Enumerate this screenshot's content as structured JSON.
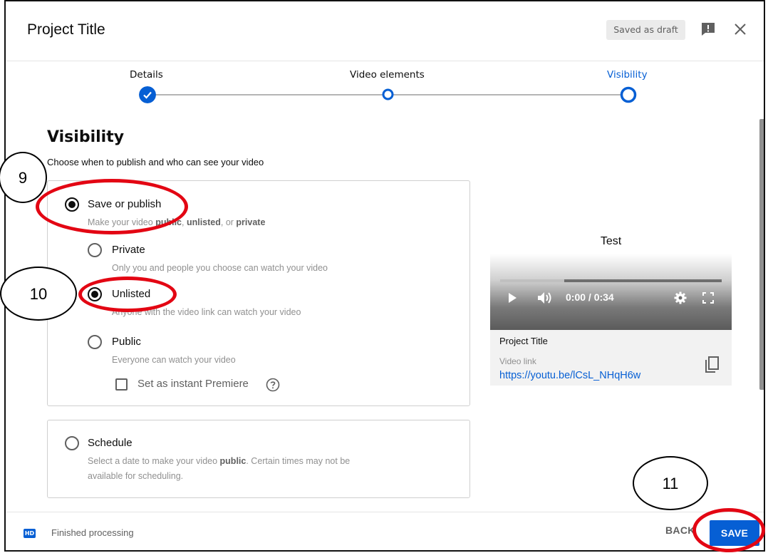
{
  "header": {
    "title": "Project Title",
    "draft_badge": "Saved as draft"
  },
  "stepper": {
    "steps": [
      {
        "label": "Details",
        "state": "completed"
      },
      {
        "label": "Video elements",
        "state": "pending"
      },
      {
        "label": "Visibility",
        "state": "current"
      }
    ]
  },
  "visibility": {
    "title": "Visibility",
    "subtitle": "Choose when to publish and who can see your video",
    "save_publish": {
      "label": "Save or publish",
      "desc_prefix": "Make your video ",
      "desc_public": "public",
      "desc_sep": ", ",
      "desc_unlisted": "unlisted",
      "desc_or": ", or ",
      "desc_private": "private",
      "selected": true
    },
    "options": [
      {
        "label": "Private",
        "desc": "Only you and people you choose can watch your video",
        "selected": false
      },
      {
        "label": "Unlisted",
        "desc": "Anyone with the video link can watch your video",
        "selected": true
      },
      {
        "label": "Public",
        "desc": "Everyone can watch your video",
        "selected": false
      }
    ],
    "premiere_label": "Set as instant Premiere",
    "schedule": {
      "label": "Schedule",
      "desc_prefix": "Select a date to make your video ",
      "desc_bold": "public",
      "desc_suffix": ". Certain times may not be",
      "desc_line2": "available for scheduling."
    }
  },
  "preview": {
    "title": "Test",
    "time": "0:00 / 0:34",
    "progress_fraction": 0.29,
    "video_title": "Project Title",
    "link_label": "Video link",
    "link": "https://youtu.be/lCsL_NHqH6w"
  },
  "footer": {
    "hd_label": "HD",
    "status": "Finished processing",
    "back_label": "BACK",
    "save_label": "SAVE"
  },
  "annotations": {
    "n9": "9",
    "n10": "10",
    "n11": "11"
  },
  "colors": {
    "accent": "#065fd4",
    "highlight": "#e30613"
  }
}
